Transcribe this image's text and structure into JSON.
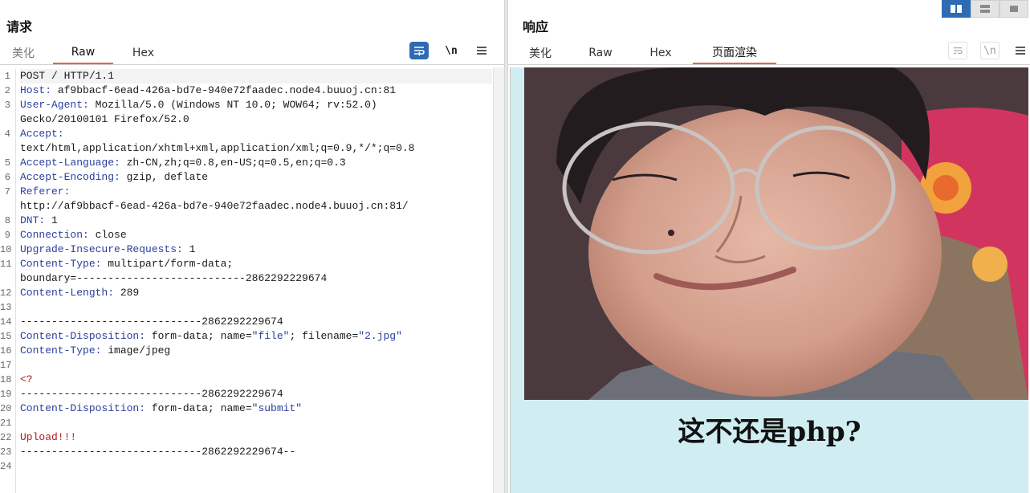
{
  "request": {
    "title": "请求",
    "tabs": [
      {
        "label": "美化",
        "active": false
      },
      {
        "label": "Raw",
        "active": true
      },
      {
        "label": "Hex",
        "active": false
      }
    ],
    "tools": {
      "wrap_icon": "wrap-lines-icon",
      "newline_label": "\\n",
      "menu_icon": "hamburger-menu-icon"
    },
    "lines": [
      {
        "n": "1",
        "parts": [
          {
            "t": "POST / HTTP/1.1",
            "c": ""
          }
        ]
      },
      {
        "n": "2",
        "parts": [
          {
            "t": "Host:",
            "c": "hk"
          },
          {
            "t": " af9bbacf-6ead-426a-bd7e-940e72faadec.node4.buuoj.cn:81",
            "c": ""
          }
        ]
      },
      {
        "n": "3",
        "parts": [
          {
            "t": "User-Agent:",
            "c": "hk"
          },
          {
            "t": " Mozilla/5.0 (Windows NT 10.0; WOW64; rv:52.0)",
            "c": ""
          }
        ]
      },
      {
        "n": "",
        "parts": [
          {
            "t": "Gecko/20100101 Firefox/52.0",
            "c": ""
          }
        ]
      },
      {
        "n": "4",
        "parts": [
          {
            "t": "Accept:",
            "c": "hk"
          }
        ]
      },
      {
        "n": "",
        "parts": [
          {
            "t": "text/html,application/xhtml+xml,application/xml;q=0.9,*/*;q=0.8",
            "c": ""
          }
        ]
      },
      {
        "n": "5",
        "parts": [
          {
            "t": "Accept-Language:",
            "c": "hk"
          },
          {
            "t": " zh-CN,zh;q=0.8,en-US;q=0.5,en;q=0.3",
            "c": ""
          }
        ]
      },
      {
        "n": "6",
        "parts": [
          {
            "t": "Accept-Encoding:",
            "c": "hk"
          },
          {
            "t": " gzip, deflate",
            "c": ""
          }
        ]
      },
      {
        "n": "7",
        "parts": [
          {
            "t": "Referer:",
            "c": "hk"
          }
        ]
      },
      {
        "n": "",
        "parts": [
          {
            "t": "http://af9bbacf-6ead-426a-bd7e-940e72faadec.node4.buuoj.cn:81/",
            "c": ""
          }
        ]
      },
      {
        "n": "8",
        "parts": [
          {
            "t": "DNT:",
            "c": "hk"
          },
          {
            "t": " 1",
            "c": ""
          }
        ]
      },
      {
        "n": "9",
        "parts": [
          {
            "t": "Connection:",
            "c": "hk"
          },
          {
            "t": " close",
            "c": ""
          }
        ]
      },
      {
        "n": "10",
        "parts": [
          {
            "t": "Upgrade-Insecure-Requests:",
            "c": "hk"
          },
          {
            "t": " 1",
            "c": ""
          }
        ]
      },
      {
        "n": "11",
        "parts": [
          {
            "t": "Content-Type:",
            "c": "hk"
          },
          {
            "t": " multipart/form-data;",
            "c": ""
          }
        ]
      },
      {
        "n": "",
        "parts": [
          {
            "t": "boundary=---------------------------2862292229674",
            "c": ""
          }
        ]
      },
      {
        "n": "12",
        "parts": [
          {
            "t": "Content-Length:",
            "c": "hk"
          },
          {
            "t": " 289",
            "c": ""
          }
        ]
      },
      {
        "n": "13",
        "parts": []
      },
      {
        "n": "14",
        "parts": [
          {
            "t": "-----------------------------2862292229674",
            "c": ""
          }
        ]
      },
      {
        "n": "15",
        "parts": [
          {
            "t": "Content-Disposition:",
            "c": "hk"
          },
          {
            "t": " form-data; name=",
            "c": ""
          },
          {
            "t": "\"file\"",
            "c": "sv"
          },
          {
            "t": "; filename=",
            "c": ""
          },
          {
            "t": "\"2.jpg\"",
            "c": "sv"
          }
        ]
      },
      {
        "n": "16",
        "parts": [
          {
            "t": "Content-Type:",
            "c": "hk"
          },
          {
            "t": " image/jpeg",
            "c": ""
          }
        ]
      },
      {
        "n": "17",
        "parts": []
      },
      {
        "n": "18",
        "parts": [
          {
            "t": "<?",
            "c": "red"
          }
        ]
      },
      {
        "n": "19",
        "parts": [
          {
            "t": "-----------------------------2862292229674",
            "c": ""
          }
        ]
      },
      {
        "n": "20",
        "parts": [
          {
            "t": "Content-Disposition:",
            "c": "hk"
          },
          {
            "t": " form-data; name=",
            "c": ""
          },
          {
            "t": "\"submit\"",
            "c": "sv"
          }
        ]
      },
      {
        "n": "21",
        "parts": []
      },
      {
        "n": "22",
        "parts": [
          {
            "t": "Upload!!!",
            "c": "red"
          }
        ]
      },
      {
        "n": "23",
        "parts": [
          {
            "t": "-----------------------------2862292229674--",
            "c": ""
          }
        ]
      },
      {
        "n": "24",
        "parts": []
      }
    ]
  },
  "response": {
    "title": "响应",
    "tabs": [
      {
        "label": "美化",
        "active": false
      },
      {
        "label": "Raw",
        "active": false
      },
      {
        "label": "Hex",
        "active": false
      },
      {
        "label": "页面渲染",
        "active": true
      }
    ],
    "tools": {
      "wrap_icon": "wrap-lines-icon",
      "newline_label": "\\n",
      "menu_icon": "hamburger-menu-icon"
    },
    "layout_buttons": [
      "split-horizontal-layout-icon",
      "split-vertical-layout-icon",
      "single-pane-layout-icon"
    ],
    "rendered": {
      "image": "person-wearing-glasses-photo",
      "caption": "这不还是php?",
      "background": "#d0eef2"
    }
  },
  "colors": {
    "accent": "#e8643a",
    "header_key": "#2a3f9e",
    "red_text": "#b01c1c",
    "active_button": "#2d6bb3"
  }
}
